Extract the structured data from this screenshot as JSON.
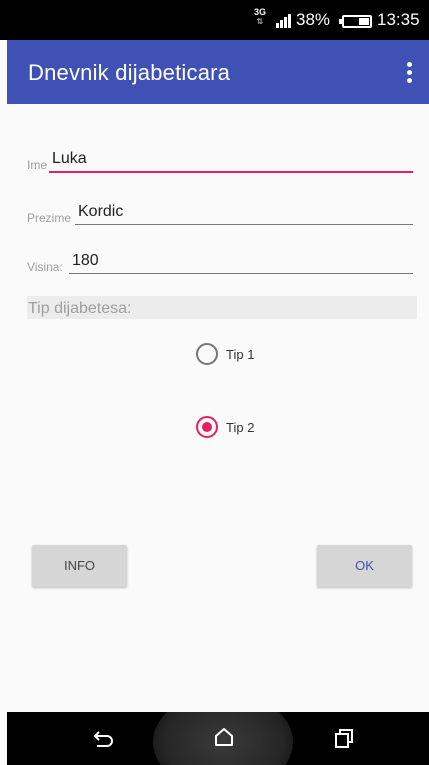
{
  "status_bar": {
    "network": "3G",
    "battery_percent": "38%",
    "battery_level": 0.38,
    "time": "13:35",
    "icons": [
      "network-3g-icon",
      "signal-icon",
      "battery-icon"
    ]
  },
  "app_bar": {
    "title": "Dnevnik dijabeticara",
    "menu_icon": "more-vert-icon"
  },
  "form": {
    "ime": {
      "label": "Ime",
      "value": "Luka"
    },
    "prezime": {
      "label": "Prezime",
      "value": "Kordic"
    },
    "visina": {
      "label": "Visina:",
      "value": "180"
    },
    "tip_header": "Tip dijabetesa:",
    "tip_options": [
      {
        "label": "Tip 1",
        "checked": false
      },
      {
        "label": "Tip 2",
        "checked": true
      }
    ]
  },
  "buttons": {
    "info": "INFO",
    "ok": "OK"
  },
  "colors": {
    "primary": "#3f51b5",
    "accent": "#e91e63",
    "background": "#fafafa"
  },
  "nav_bar": {
    "icons": [
      "back-icon",
      "home-icon",
      "recents-icon"
    ]
  }
}
